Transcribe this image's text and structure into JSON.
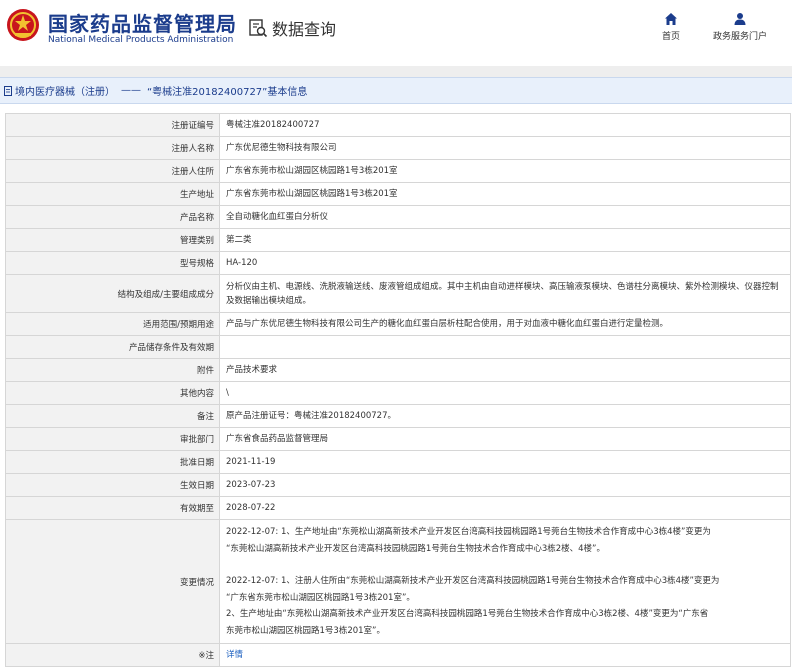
{
  "header": {
    "title_cn": "国家药品监督管理局",
    "title_en": "National Medical Products Administration",
    "data_query": "数据查询",
    "nav": [
      {
        "label": "首页",
        "icon": "home-icon"
      },
      {
        "label": "政务服务门户",
        "icon": "person-icon"
      }
    ]
  },
  "breadcrumb": {
    "category": "境内医疗器械（注册）",
    "separator": "——",
    "current": "“粤械注准20182400727”基本信息"
  },
  "rows": [
    {
      "label": "注册证编号",
      "value": "粤械注准20182400727"
    },
    {
      "label": "注册人名称",
      "value": "广东优尼德生物科技有限公司"
    },
    {
      "label": "注册人住所",
      "value": "广东省东莞市松山湖园区桃园路1号3栋201室"
    },
    {
      "label": "生产地址",
      "value": "广东省东莞市松山湖园区桃园路1号3栋201室"
    },
    {
      "label": "产品名称",
      "value": "全自动糖化血红蛋白分析仪"
    },
    {
      "label": "管理类别",
      "value": "第二类"
    },
    {
      "label": "型号规格",
      "value": "HA-120"
    },
    {
      "label": "结构及组成/主要组成成分",
      "value": "分析仪由主机、电源线、洗脱液输送线、废液管组成组成。其中主机由自动进样模块、高压输液泵模块、色谱柱分离模块、紫外检测模块、仪器控制及数据输出模块组成。"
    },
    {
      "label": "适用范围/预期用途",
      "value": "产品与广东优尼德生物科技有限公司生产的糖化血红蛋白层析柱配合使用，用于对血液中糖化血红蛋白进行定量检测。"
    },
    {
      "label": "产品储存条件及有效期",
      "value": ""
    },
    {
      "label": "附件",
      "value": "产品技术要求"
    },
    {
      "label": "其他内容",
      "value": "\\"
    },
    {
      "label": "备注",
      "value": "原产品注册证号：粤械注准20182400727。"
    },
    {
      "label": "审批部门",
      "value": "广东省食品药品监督管理局"
    },
    {
      "label": "批准日期",
      "value": "2021-11-19"
    },
    {
      "label": "生效日期",
      "value": "2023-07-23"
    },
    {
      "label": "有效期至",
      "value": "2028-07-22"
    }
  ],
  "changes": {
    "label": "变更情况",
    "lines": [
      "2022-12-07: 1、生产地址由“东莞松山湖高新技术产业开发区台湾高科技园桃园路1号莞台生物技术合作育成中心3栋4楼”变更为",
      "“东莞松山湖高新技术产业开发区台湾高科技园桃园路1号莞台生物技术合作育成中心3栋2楼、4楼”。",
      "",
      "2022-12-07: 1、注册人住所由“东莞松山湖高新技术产业开发区台湾高科技园桃园路1号莞台生物技术合作育成中心3栋4楼”变更为",
      "“广东省东莞市松山湖园区桃园路1号3栋201室”。",
      "2、生产地址由“东莞松山湖高新技术产业开发区台湾高科技园桃园路1号莞台生物技术合作育成中心3栋2楼、4楼”变更为“广东省",
      "东莞市松山湖园区桃园路1号3栋201室”。"
    ]
  },
  "note": {
    "label": "※注",
    "link": "详情"
  },
  "colors": {
    "brand_blue": "#1b3c8c",
    "link_blue": "#1b5fbf",
    "label_bg": "#f2f2f2"
  }
}
